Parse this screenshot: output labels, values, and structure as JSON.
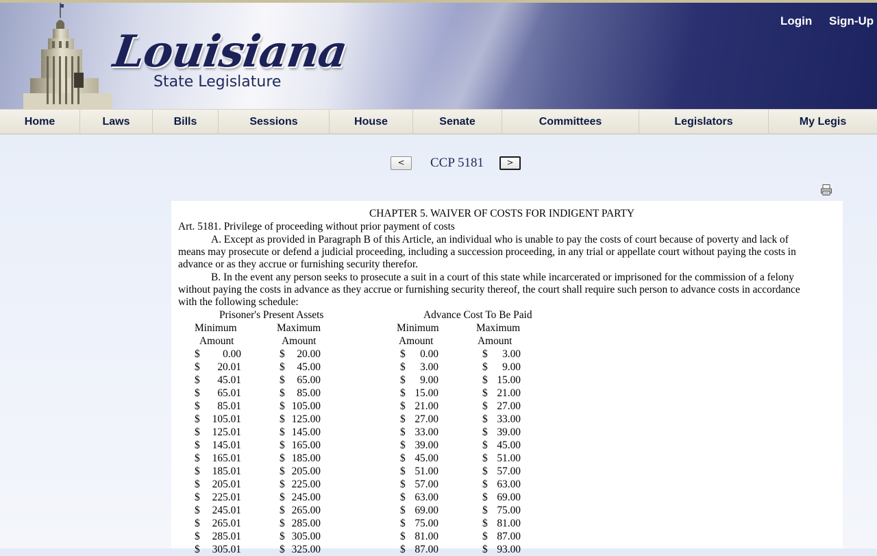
{
  "header": {
    "logo_main": "Louisiana",
    "logo_sub": "State Legislature",
    "login": "Login",
    "signup": "Sign-Up"
  },
  "nav": [
    "Home",
    "Laws",
    "Bills",
    "Sessions",
    "House",
    "Senate",
    "Committees",
    "Legislators",
    "My Legis"
  ],
  "pager": {
    "prev": "<",
    "next": ">",
    "title": "CCP 5181"
  },
  "doc": {
    "chapter": "CHAPTER 5. WAIVER OF COSTS FOR INDIGENT PARTY",
    "article": "Art. 5181. Privilege of proceeding without prior payment of costs",
    "para_a": [
      "A. Except as provided in Paragraph B of this Article, an individual who is unable to pay the costs of court because of poverty and lack of",
      "means may prosecute or defend a judicial proceeding, including a succession proceeding, in any trial or appellate court without paying the costs in",
      "advance or as they accrue or furnishing security therefor."
    ],
    "para_b": [
      "B. In the event any person seeks to prosecute a suit in a court of this state while incarcerated or imprisoned for the commission of a felony",
      "without paying the costs in advance as they accrue or furnishing security thereof, the court shall require such person to advance costs in accordance",
      "with the following schedule:"
    ],
    "table": {
      "group_left": "Prisoner's Present Assets",
      "group_right": "Advance Cost To Be Paid",
      "col_line1": [
        "Minimum",
        "Maximum",
        "Minimum",
        "Maximum"
      ],
      "col_line2": [
        "Amount",
        "Amount",
        "Amount",
        "Amount"
      ],
      "currency": "$",
      "rows": [
        [
          "0.00",
          "20.00",
          "0.00",
          "3.00"
        ],
        [
          "20.01",
          "45.00",
          "3.00",
          "9.00"
        ],
        [
          "45.01",
          "65.00",
          "9.00",
          "15.00"
        ],
        [
          "65.01",
          "85.00",
          "15.00",
          "21.00"
        ],
        [
          "85.01",
          "105.00",
          "21.00",
          "27.00"
        ],
        [
          "105.01",
          "125.00",
          "27.00",
          "33.00"
        ],
        [
          "125.01",
          "145.00",
          "33.00",
          "39.00"
        ],
        [
          "145.01",
          "165.00",
          "39.00",
          "45.00"
        ],
        [
          "165.01",
          "185.00",
          "45.00",
          "51.00"
        ],
        [
          "185.01",
          "205.00",
          "51.00",
          "57.00"
        ],
        [
          "205.01",
          "225.00",
          "57.00",
          "63.00"
        ],
        [
          "225.01",
          "245.00",
          "63.00",
          "69.00"
        ],
        [
          "245.01",
          "265.00",
          "69.00",
          "75.00"
        ],
        [
          "265.01",
          "285.00",
          "75.00",
          "81.00"
        ],
        [
          "285.01",
          "305.00",
          "81.00",
          "87.00"
        ],
        [
          "305.01",
          "325.00",
          "87.00",
          "93.00"
        ]
      ]
    }
  }
}
